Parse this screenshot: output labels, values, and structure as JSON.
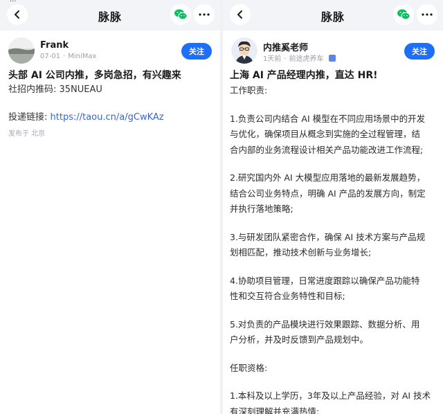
{
  "left": {
    "status_clip": "...",
    "nav_title": "脉脉",
    "author": {
      "name": "Frank",
      "date": "07-01",
      "company": "MiniMax"
    },
    "follow_label": "关注",
    "title": "头部 AI 公司内推，多岗急招，有兴趣来",
    "referral_line": "社招内推码: 35NUEAU",
    "link_prefix": "投递链接: ",
    "link_text": "https://taou.cn/a/gCwKAz",
    "location": "发布于 北京"
  },
  "right": {
    "nav_title": "脉脉",
    "author": {
      "name": "内推奚老师",
      "time": "1天前",
      "separator": "·",
      "company": "前途虎养车"
    },
    "follow_label": "关注",
    "title": "上海 AI 产品经理内推，直达 HR!",
    "lines": [
      "工作职责:",
      "",
      "1.负责公司内结合 AI 模型在不同应用场景中的开发",
      "与优化，确保项目从概念到实施的全过程管理，结",
      "合内部的业务流程设计相关产品功能改进工作流程;",
      "",
      "2.研究国内外 AI 大模型应用落地的最新发展趋势，",
      "结合公司业务特点，明确 AI 产品的发展方向，制定",
      "并执行落地策略;",
      "",
      "3.与研发团队紧密合作，确保 AI 技术方案与产品规",
      "划相匹配，推动技术创新与业务增长;",
      "",
      "4.协助项目管理，日常进度跟踪以确保产品功能特",
      "性和交互符合业务特性和目标;",
      "",
      "5.对负责的产品模块进行效果跟踪、数据分析、用",
      "户分析，并及时反馈到产品规划中。",
      "",
      "任职资格:",
      "",
      "1.本科及以上学历，3年及以上产品经验，对 AI 技术",
      "有深刻理解并充满热情;"
    ]
  },
  "icons": {
    "back": "chevron-left-icon",
    "share": "wechat-icon",
    "more": "more-dots-icon",
    "verified": "verified-badge-icon"
  },
  "colors": {
    "accent": "#1e6ff5",
    "link": "#3b64c8",
    "wechat": "#07c160"
  }
}
